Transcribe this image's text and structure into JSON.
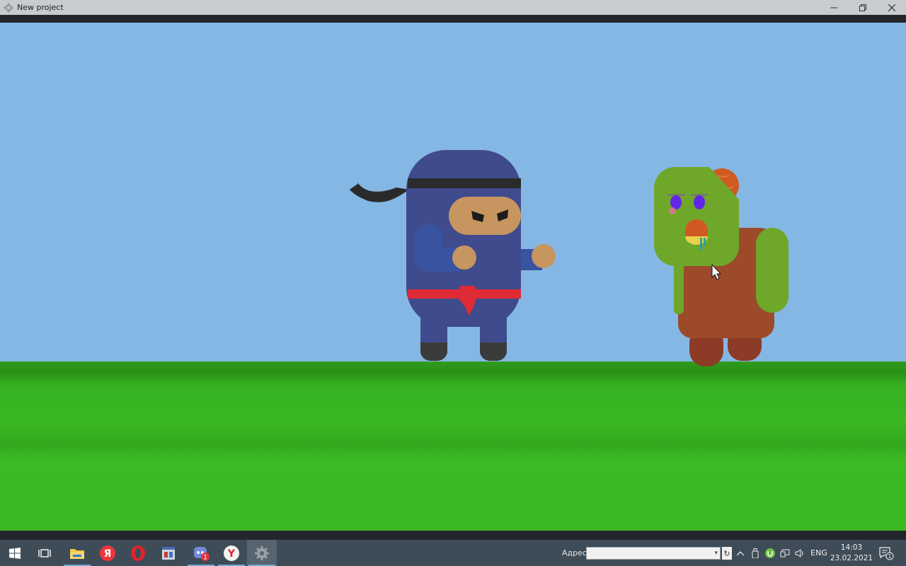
{
  "window": {
    "title": "New project",
    "controls": [
      "minimize",
      "restore",
      "close"
    ]
  },
  "scene": {
    "sky_color": "#85b7e5",
    "grass_color": "#3ab822",
    "characters": [
      {
        "name": "ninja",
        "body_color": "#3f4b8c",
        "belt_color": "#de2b36",
        "skin_color": "#c7955f"
      },
      {
        "name": "zombie",
        "head_color": "#6fa72a",
        "body_color": "#9c4a2a",
        "brain_color": "#cf5a23"
      }
    ]
  },
  "taskbar": {
    "pinned": [
      {
        "name": "start-icon"
      },
      {
        "name": "task-view-icon"
      },
      {
        "name": "file-explorer-icon",
        "running": true
      },
      {
        "name": "yandex-icon",
        "label": "Я"
      },
      {
        "name": "opera-icon"
      },
      {
        "name": "app-window-icon"
      },
      {
        "name": "discord-icon",
        "badge": "1",
        "running": true
      },
      {
        "name": "yandex-browser-icon",
        "label": "Y",
        "running": true
      },
      {
        "name": "game-engine-icon",
        "running": true,
        "active": true
      }
    ],
    "address_label": "Адрес",
    "address_value": "",
    "tray": {
      "language": "ENG",
      "time": "14:03",
      "date": "23.02.2021",
      "notifications_count": "1"
    }
  }
}
